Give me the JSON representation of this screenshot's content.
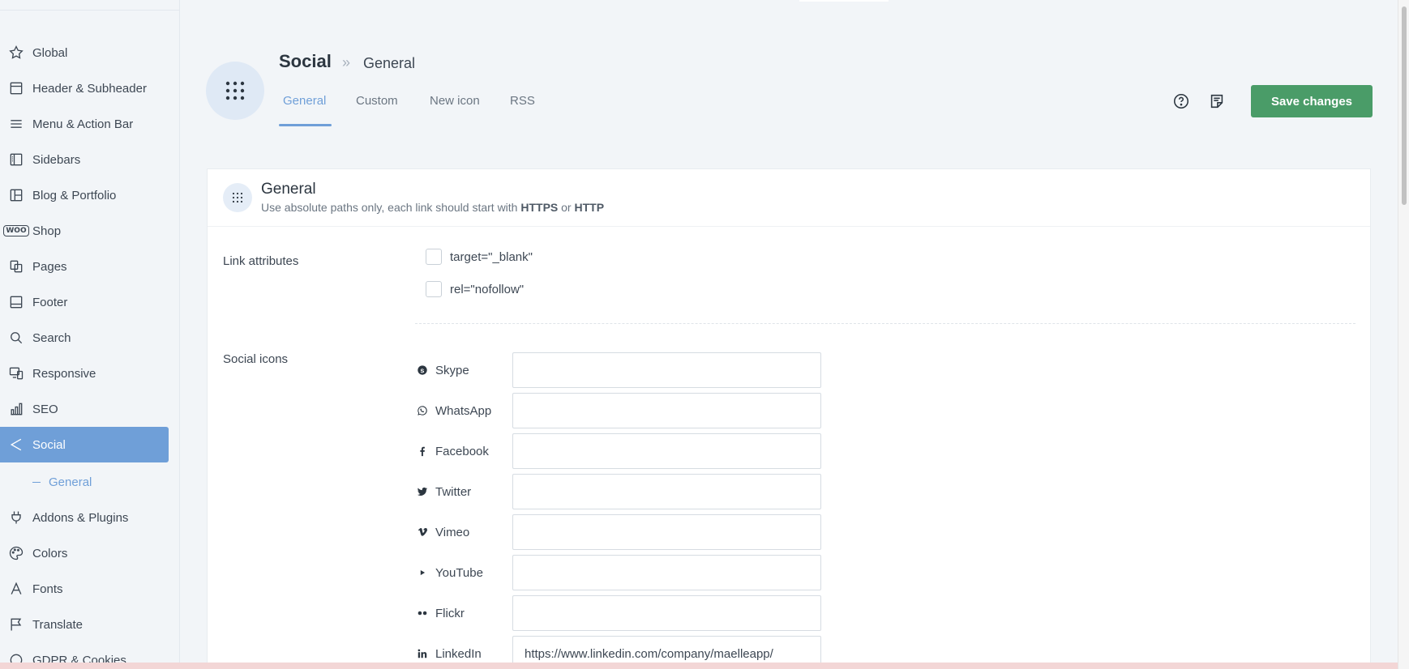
{
  "sidebar": {
    "items": [
      {
        "label": "Global",
        "icon": "star-icon"
      },
      {
        "label": "Header & Subheader",
        "icon": "header-icon"
      },
      {
        "label": "Menu & Action Bar",
        "icon": "menu-icon"
      },
      {
        "label": "Sidebars",
        "icon": "sidebar-icon"
      },
      {
        "label": "Blog & Portfolio",
        "icon": "layout-icon"
      },
      {
        "label": "Shop",
        "icon": "woo-icon",
        "badge": "WOO"
      },
      {
        "label": "Pages",
        "icon": "pages-icon"
      },
      {
        "label": "Footer",
        "icon": "footer-icon"
      },
      {
        "label": "Search",
        "icon": "search-icon"
      },
      {
        "label": "Responsive",
        "icon": "responsive-icon"
      },
      {
        "label": "SEO",
        "icon": "chart-icon"
      },
      {
        "label": "Social",
        "icon": "share-icon",
        "active": true
      },
      {
        "label": "Addons & Plugins",
        "icon": "plug-icon"
      },
      {
        "label": "Colors",
        "icon": "palette-icon"
      },
      {
        "label": "Fonts",
        "icon": "font-icon"
      },
      {
        "label": "Translate",
        "icon": "flag-icon"
      },
      {
        "label": "GDPR & Cookies",
        "icon": "cookie-icon"
      }
    ],
    "sub_item": {
      "label": "General",
      "active": true
    }
  },
  "header": {
    "title": "Social",
    "breadcrumb_sep": "»",
    "breadcrumb": "General",
    "tabs": [
      {
        "label": "General",
        "active": true
      },
      {
        "label": "Custom"
      },
      {
        "label": "New icon"
      },
      {
        "label": "RSS"
      }
    ],
    "save_label": "Save changes"
  },
  "card": {
    "title": "General",
    "desc_prefix": "Use absolute paths only, each link should start with ",
    "desc_https": "HTTPS",
    "desc_or": " or ",
    "desc_http": "HTTP",
    "link_attributes_label": "Link attributes",
    "checkboxes": [
      {
        "label": "target=\"_blank\"",
        "checked": false
      },
      {
        "label": "rel=\"nofollow\"",
        "checked": false
      }
    ],
    "social_icons_label": "Social icons",
    "social": [
      {
        "label": "Skype",
        "icon": "skype-icon",
        "value": ""
      },
      {
        "label": "WhatsApp",
        "icon": "whatsapp-icon",
        "value": ""
      },
      {
        "label": "Facebook",
        "icon": "facebook-icon",
        "value": ""
      },
      {
        "label": "Twitter",
        "icon": "twitter-icon",
        "value": ""
      },
      {
        "label": "Vimeo",
        "icon": "vimeo-icon",
        "value": ""
      },
      {
        "label": "YouTube",
        "icon": "youtube-icon",
        "value": ""
      },
      {
        "label": "Flickr",
        "icon": "flickr-icon",
        "value": ""
      },
      {
        "label": "LinkedIn",
        "icon": "linkedin-icon",
        "value": "https://www.linkedin.com/company/maelleapp/"
      }
    ]
  },
  "colors": {
    "accent": "#6f9fd8",
    "save": "#4a9c68",
    "text": "#3d4753",
    "background": "#f2f5f8"
  }
}
